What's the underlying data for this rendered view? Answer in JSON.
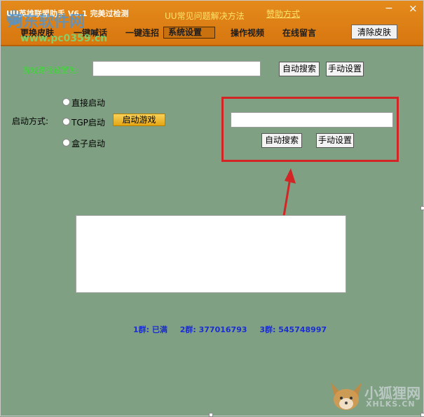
{
  "window": {
    "title": "UU英雄联盟助手 V6.1 完美过检测",
    "faq_link": "UU常见问题解决方法",
    "help_link": "赞助方式",
    "close_glyph": "×",
    "minimize_glyph": "−"
  },
  "watermark": {
    "site_name": "河东软件网",
    "site_url": "www.pc0359.cn",
    "corner_name": "小狐狸网",
    "corner_url": "XHLKS.CN"
  },
  "nav": {
    "items": [
      "更换皮肤",
      "一键喊话",
      "一键连招",
      "系统设置",
      "操作视频",
      "在线留言"
    ],
    "active": "系统设置",
    "clear_skin": "清除皮肤"
  },
  "settings": {
    "game_path_label": "游戏路径设置为:",
    "game_path_value": "",
    "auto_search": "自动搜索",
    "manual_set": "手动设置",
    "start_mode_label": "启动方式:",
    "start_options": [
      "直接启动",
      "TGP启动",
      "盒子启动"
    ],
    "launch_game": "启动游戏",
    "tgp_path_value": ""
  },
  "groups": {
    "group1": "1群: 已满",
    "group2": "2群: 377016793",
    "group3": "3群: 545748997"
  },
  "colors": {
    "header": "#e48a1b",
    "body_bg": "#7fa082",
    "highlight": "#d22626",
    "group_text": "#1a2ed1",
    "label_green": "#3bdc34"
  }
}
